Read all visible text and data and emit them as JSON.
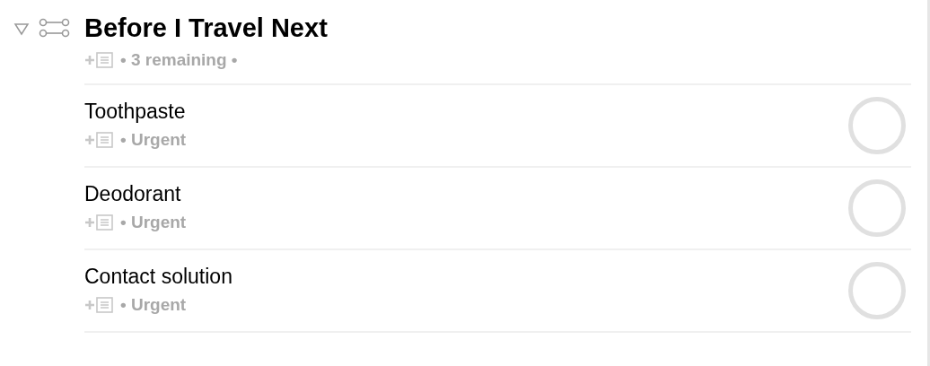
{
  "project": {
    "title": "Before I Travel Next",
    "expanded": true,
    "status": "• 3 remaining •"
  },
  "tasks": [
    {
      "name": "Toothpaste",
      "tag": "• Urgent",
      "checked": false
    },
    {
      "name": "Deodorant",
      "tag": "• Urgent",
      "checked": false
    },
    {
      "name": "Contact solution",
      "tag": "• Urgent",
      "checked": false
    }
  ]
}
